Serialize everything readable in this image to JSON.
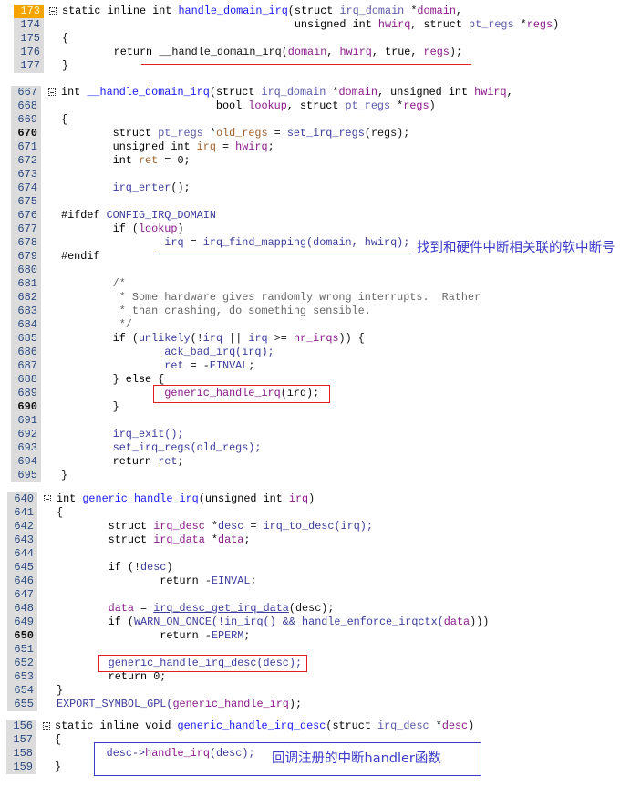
{
  "colors": {
    "highlight_line": "#f5a300",
    "underline_red": "#e02020",
    "underline_blue": "#3030c0",
    "box_red": "#e02020",
    "box_blue": "#3b3bc8"
  },
  "blocks": [
    {
      "lines": [
        {
          "n": "173",
          "hl": true,
          "t": [
            [
              "static inline int ",
              "k"
            ],
            [
              "handle_domain_irq",
              "f"
            ],
            [
              "(",
              "n"
            ],
            [
              "struct ",
              "k"
            ],
            [
              "irq_domain",
              "t"
            ],
            [
              " *",
              "n"
            ],
            [
              "domain",
              "p"
            ],
            [
              ",",
              "n"
            ]
          ]
        },
        {
          "n": "174",
          "t": [
            [
              "                                    unsigned int ",
              "k"
            ],
            [
              "hwirq",
              "p"
            ],
            [
              ", ",
              "n"
            ],
            [
              "struct ",
              "k"
            ],
            [
              "pt_regs",
              "t"
            ],
            [
              " *",
              "n"
            ],
            [
              "regs",
              "p"
            ],
            [
              ")",
              "n"
            ]
          ]
        },
        {
          "n": "175",
          "t": [
            [
              "{",
              "n"
            ]
          ]
        },
        {
          "n": "176",
          "t": [
            [
              "        return ",
              "k"
            ],
            [
              "__handle_domain_irq(",
              "n"
            ],
            [
              "domain",
              "p"
            ],
            [
              ", ",
              "n"
            ],
            [
              "hwirq",
              "p"
            ],
            [
              ", ",
              "n"
            ],
            [
              "true",
              "k"
            ],
            [
              ", ",
              "n"
            ],
            [
              "regs",
              "p"
            ],
            [
              ");",
              "n"
            ]
          ]
        },
        {
          "n": "177",
          "t": [
            [
              "}",
              "n"
            ]
          ]
        }
      ]
    },
    {
      "lines": [
        {
          "n": "667",
          "t": [
            [
              "int ",
              "k"
            ],
            [
              "__handle_domain_irq",
              "f"
            ],
            [
              "(",
              "n"
            ],
            [
              "struct ",
              "k"
            ],
            [
              "irq_domain",
              "t"
            ],
            [
              " *",
              "n"
            ],
            [
              "domain",
              "p"
            ],
            [
              ", ",
              "n"
            ],
            [
              "unsigned int ",
              "k"
            ],
            [
              "hwirq",
              "p"
            ],
            [
              ",",
              "n"
            ]
          ]
        },
        {
          "n": "668",
          "t": [
            [
              "                        bool ",
              "k"
            ],
            [
              "lookup",
              "p"
            ],
            [
              ", ",
              "n"
            ],
            [
              "struct ",
              "k"
            ],
            [
              "pt_regs",
              "t"
            ],
            [
              " *",
              "n"
            ],
            [
              "regs",
              "p"
            ],
            [
              ")",
              "n"
            ]
          ]
        },
        {
          "n": "669",
          "t": [
            [
              "{",
              "n"
            ]
          ]
        },
        {
          "n": "670",
          "b": true,
          "t": [
            [
              "        struct ",
              "k"
            ],
            [
              "pt_regs",
              "t"
            ],
            [
              " *",
              "n"
            ],
            [
              "old_regs",
              "v"
            ],
            [
              " = ",
              "n"
            ],
            [
              "set_irq_regs",
              "m"
            ],
            [
              "(regs);",
              "n"
            ]
          ]
        },
        {
          "n": "671",
          "t": [
            [
              "        unsigned int ",
              "k"
            ],
            [
              "irq",
              "v"
            ],
            [
              " = ",
              "n"
            ],
            [
              "hwirq",
              "p"
            ],
            [
              ";",
              "n"
            ]
          ]
        },
        {
          "n": "672",
          "t": [
            [
              "        int ",
              "k"
            ],
            [
              "ret",
              "v"
            ],
            [
              " = 0;",
              "n"
            ]
          ]
        },
        {
          "n": "673",
          "t": []
        },
        {
          "n": "674",
          "t": [
            [
              "        ",
              "n"
            ],
            [
              "irq_enter",
              "m"
            ],
            [
              "();",
              "n"
            ]
          ]
        },
        {
          "n": "675",
          "t": []
        },
        {
          "n": "676",
          "t": [
            [
              "#ifdef ",
              "k"
            ],
            [
              "CONFIG_IRQ_DOMAIN",
              "m"
            ]
          ]
        },
        {
          "n": "677",
          "t": [
            [
              "        if ",
              "k"
            ],
            [
              "(",
              "n"
            ],
            [
              "lookup",
              "p"
            ],
            [
              ")",
              "n"
            ]
          ]
        },
        {
          "n": "678",
          "t": [
            [
              "                ",
              "n"
            ],
            [
              "irq",
              "m"
            ],
            [
              " = ",
              "n"
            ],
            [
              "irq_find_mapping(domain, hwirq);",
              "m"
            ]
          ]
        },
        {
          "n": "679",
          "t": [
            [
              "#endif",
              "k"
            ]
          ]
        },
        {
          "n": "680",
          "t": []
        },
        {
          "n": "681",
          "t": [
            [
              "        /*",
              "c"
            ]
          ]
        },
        {
          "n": "682",
          "t": [
            [
              "         * Some hardware gives randomly wrong interrupts.  Rather",
              "c"
            ]
          ]
        },
        {
          "n": "683",
          "t": [
            [
              "         * than crashing, do something sensible.",
              "c"
            ]
          ]
        },
        {
          "n": "684",
          "t": [
            [
              "         */",
              "c"
            ]
          ]
        },
        {
          "n": "685",
          "t": [
            [
              "        if ",
              "k"
            ],
            [
              "(",
              "n"
            ],
            [
              "unlikely",
              "m"
            ],
            [
              "(!",
              "n"
            ],
            [
              "irq",
              "m"
            ],
            [
              " || ",
              "n"
            ],
            [
              "irq",
              "m"
            ],
            [
              " >= ",
              "n"
            ],
            [
              "nr_irqs",
              "p"
            ],
            [
              ")) {",
              "n"
            ]
          ]
        },
        {
          "n": "686",
          "t": [
            [
              "                ",
              "n"
            ],
            [
              "ack_bad_irq(irq);",
              "m"
            ]
          ]
        },
        {
          "n": "687",
          "t": [
            [
              "                ",
              "n"
            ],
            [
              "ret",
              "m"
            ],
            [
              " = -",
              "n"
            ],
            [
              "EINVAL",
              "m"
            ],
            [
              ";",
              "n"
            ]
          ]
        },
        {
          "n": "688",
          "t": [
            [
              "        } ",
              "n"
            ],
            [
              "else",
              "k"
            ],
            [
              " {",
              "n"
            ]
          ]
        },
        {
          "n": "689",
          "t": [
            [
              "                ",
              "n"
            ],
            [
              "generic_handle_irq",
              "p"
            ],
            [
              "(irq);",
              "n"
            ]
          ]
        },
        {
          "n": "690",
          "b": true,
          "t": [
            [
              "        }",
              "n"
            ]
          ]
        },
        {
          "n": "691",
          "t": []
        },
        {
          "n": "692",
          "t": [
            [
              "        ",
              "n"
            ],
            [
              "irq_exit();",
              "m"
            ]
          ]
        },
        {
          "n": "693",
          "t": [
            [
              "        ",
              "n"
            ],
            [
              "set_irq_regs(old_regs);",
              "m"
            ]
          ]
        },
        {
          "n": "694",
          "t": [
            [
              "        return ",
              "k"
            ],
            [
              "ret",
              "m"
            ],
            [
              ";",
              "n"
            ]
          ]
        },
        {
          "n": "695",
          "t": [
            [
              "}",
              "n"
            ]
          ]
        }
      ]
    },
    {
      "lines": [
        {
          "n": "640",
          "t": [
            [
              "int ",
              "k"
            ],
            [
              "generic_handle_irq",
              "f"
            ],
            [
              "(",
              "n"
            ],
            [
              "unsigned int ",
              "k"
            ],
            [
              "irq",
              "p"
            ],
            [
              ")",
              "n"
            ]
          ]
        },
        {
          "n": "641",
          "t": [
            [
              "{",
              "n"
            ]
          ]
        },
        {
          "n": "642",
          "t": [
            [
              "        struct ",
              "k"
            ],
            [
              "irq_desc",
              "p"
            ],
            [
              " *",
              "n"
            ],
            [
              "desc",
              "m"
            ],
            [
              " = ",
              "n"
            ],
            [
              "irq_to_desc(irq);",
              "m"
            ]
          ]
        },
        {
          "n": "643",
          "t": [
            [
              "        struct ",
              "k"
            ],
            [
              "irq_data",
              "p"
            ],
            [
              " *",
              "n"
            ],
            [
              "data",
              "p"
            ],
            [
              ";",
              "n"
            ]
          ]
        },
        {
          "n": "644",
          "t": []
        },
        {
          "n": "645",
          "t": [
            [
              "        if ",
              "k"
            ],
            [
              "(!",
              "n"
            ],
            [
              "desc",
              "m"
            ],
            [
              ")",
              "n"
            ]
          ]
        },
        {
          "n": "646",
          "t": [
            [
              "                return ",
              "k"
            ],
            [
              "-",
              "n"
            ],
            [
              "EINVAL",
              "m"
            ],
            [
              ";",
              "n"
            ]
          ]
        },
        {
          "n": "647",
          "t": []
        },
        {
          "n": "648",
          "t": [
            [
              "        ",
              "n"
            ],
            [
              "data",
              "p"
            ],
            [
              " = ",
              "n"
            ],
            [
              "irq_desc_get_irq_data",
              "u"
            ],
            [
              "(desc);",
              "n"
            ]
          ]
        },
        {
          "n": "649",
          "t": [
            [
              "        if ",
              "k"
            ],
            [
              "(",
              "n"
            ],
            [
              "WARN_ON_ONCE(!in_irq() && handle_enforce_irqctx(",
              "m"
            ],
            [
              "data",
              "p"
            ],
            [
              ")))",
              "n"
            ]
          ]
        },
        {
          "n": "650",
          "b": true,
          "t": [
            [
              "                return ",
              "k"
            ],
            [
              "-",
              "n"
            ],
            [
              "EPERM",
              "m"
            ],
            [
              ";",
              "n"
            ]
          ]
        },
        {
          "n": "651",
          "t": []
        },
        {
          "n": "652",
          "t": [
            [
              "        ",
              "n"
            ],
            [
              "generic_handle_irq_desc(desc);",
              "m"
            ]
          ]
        },
        {
          "n": "653",
          "t": [
            [
              "        return ",
              "k"
            ],
            [
              "0;",
              "n"
            ]
          ]
        },
        {
          "n": "654",
          "t": [
            [
              "}",
              "n"
            ]
          ]
        },
        {
          "n": "655",
          "t": [
            [
              "EXPORT_SYMBOL_GPL(",
              "m"
            ],
            [
              "generic_handle_irq",
              "p"
            ],
            [
              ");",
              "n"
            ]
          ]
        }
      ]
    },
    {
      "lines": [
        {
          "n": "156",
          "t": [
            [
              "static inline void ",
              "k"
            ],
            [
              "generic_handle_irq_desc",
              "f"
            ],
            [
              "(",
              "n"
            ],
            [
              "struct ",
              "k"
            ],
            [
              "irq_desc",
              "t"
            ],
            [
              " *",
              "n"
            ],
            [
              "desc",
              "p"
            ],
            [
              ")",
              "n"
            ]
          ]
        },
        {
          "n": "157",
          "t": [
            [
              "{",
              "n"
            ]
          ]
        },
        {
          "n": "158",
          "t": [
            [
              "        ",
              "n"
            ],
            [
              "desc->",
              "m"
            ],
            [
              "handle_irq",
              "p"
            ],
            [
              "(desc);",
              "m"
            ]
          ]
        },
        {
          "n": "159",
          "t": [
            [
              "}",
              "n"
            ]
          ]
        }
      ]
    }
  ],
  "annotations": {
    "find_mapping_note": "找到和硬件中断相关联的软中断号",
    "callback_note": "回调注册的中断handler函数"
  }
}
